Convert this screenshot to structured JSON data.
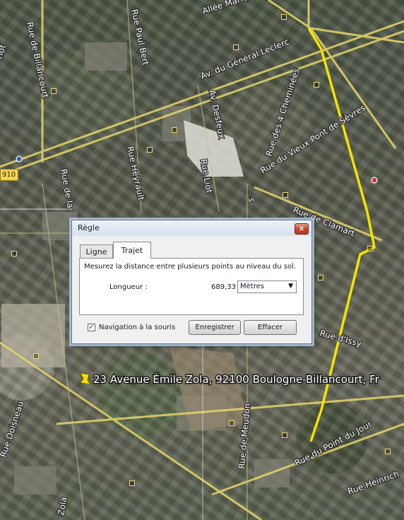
{
  "map": {
    "road_badge": "910",
    "streets": [
      "Allée Marie",
      "Rue Paul Bert",
      "Rue de Billancourt",
      "Av. du Général Leclerc",
      "Av. Desfeux",
      "Rue des 4 Cheminées",
      "Rue du Vieux Pont de Sèvres",
      "Rue Heyrault",
      "Rue de la",
      "Rue Liot",
      "Rue de Clamart",
      "Rue d'Issy",
      "Rue de Meudon",
      "Rue du Point du Jour",
      "Rue Heinrich",
      "Rue Doisneau",
      "Zola",
      "riot",
      "s"
    ],
    "address_label": "23 Avenue Émile Zola, 92100 Boulogne-Billancourt, Fr",
    "colors": {
      "route": "#f5e400",
      "road": "#e8d66a",
      "ruler": "#ffffff"
    }
  },
  "dialog": {
    "title": "Règle",
    "close_glyph": "x",
    "tabs": [
      {
        "label": "Ligne",
        "active": false
      },
      {
        "label": "Trajet",
        "active": true
      }
    ],
    "description": "Mesurez la distance entre plusieurs points au niveau du sol.",
    "length_label": "Longueur :",
    "length_value": "689,33",
    "unit_selected": "Mètres",
    "unit_arrow": "▼",
    "mouse_nav_label": "Navigation à la souris",
    "mouse_nav_checked": true,
    "check_glyph": "✓",
    "save_label": "Enregistrer",
    "clear_label": "Effacer"
  }
}
